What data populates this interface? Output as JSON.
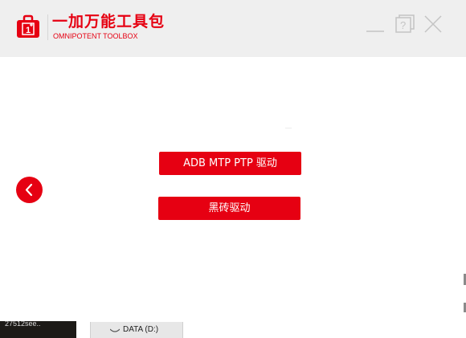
{
  "app": {
    "title": "一加万能工具包",
    "subtitle": "OMNIPOTENT TOOLBOX",
    "logo_icon": "oneplus-bag-icon",
    "brand_color": "#e60012"
  },
  "window_controls": {
    "minimize_icon": "minimize-icon",
    "help_icon": "help-icon",
    "help_glyph": "?",
    "close_icon": "close-icon"
  },
  "main": {
    "buttons": [
      {
        "label": "ADB MTP PTP 驱动"
      },
      {
        "label": "黑砖驱动"
      }
    ],
    "back_icon": "chevron-left-icon"
  },
  "taskbar": {
    "thumbnail_text": "27512see..",
    "drive_label": "DATA (D:)",
    "drive_icon": "drive-icon"
  }
}
